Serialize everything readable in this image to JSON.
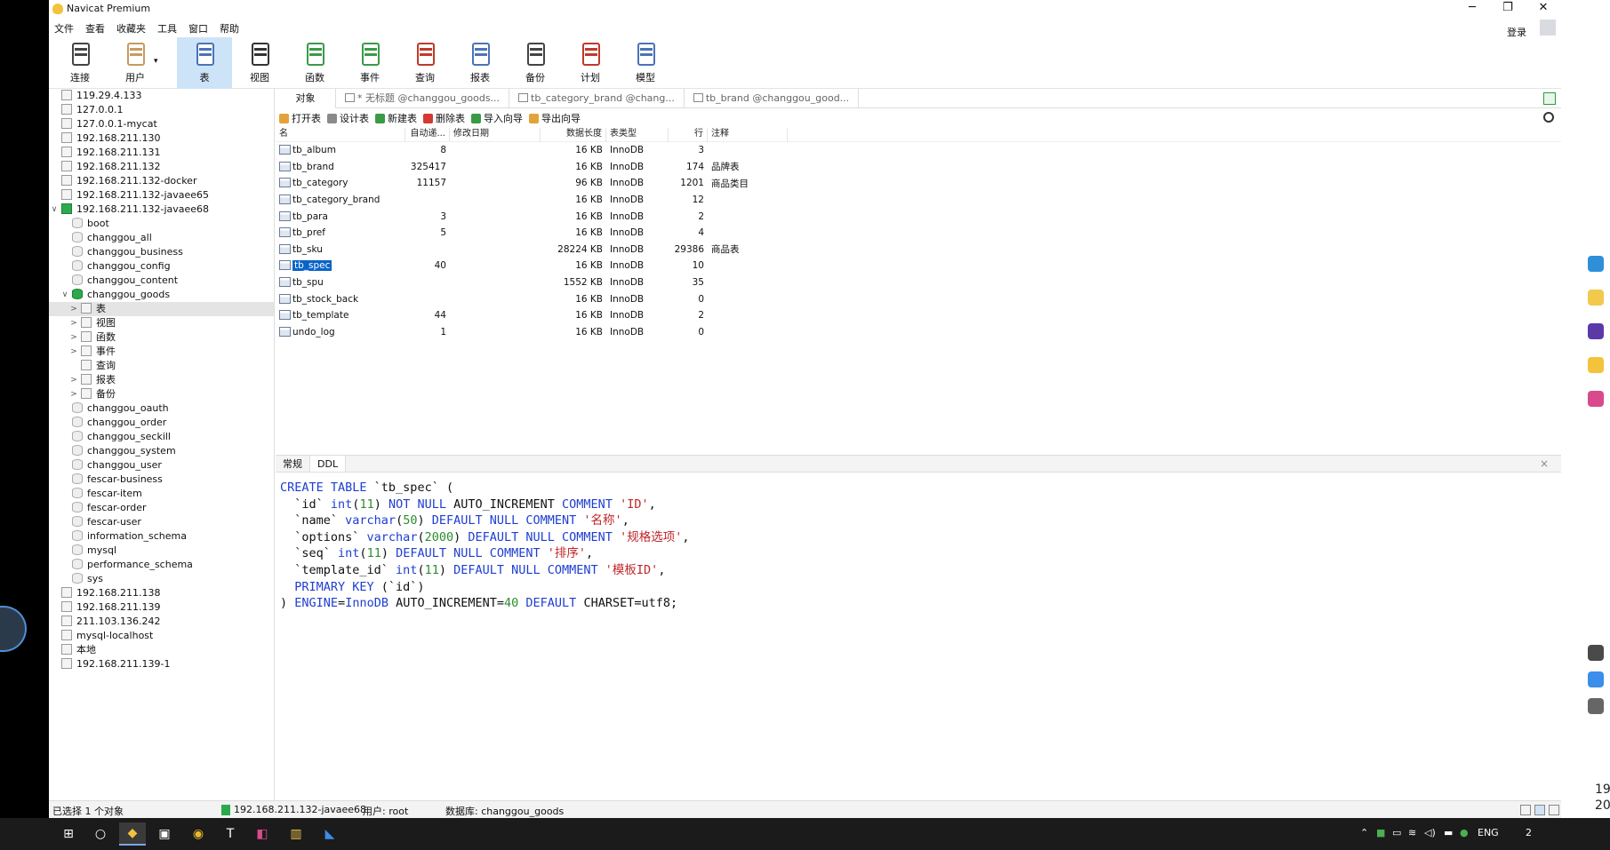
{
  "app": {
    "title": "Navicat Premium",
    "window_buttons": [
      "─",
      "❐",
      "✕"
    ],
    "login_label": "登录"
  },
  "menu": [
    "文件",
    "查看",
    "收藏夹",
    "工具",
    "窗口",
    "帮助"
  ],
  "toolbar": [
    {
      "label": "连接",
      "icon": "plug-icon",
      "color": "#444444"
    },
    {
      "label": "用户",
      "icon": "user-icon",
      "color": "#c89a62"
    },
    {
      "label": "表",
      "icon": "table-icon",
      "color": "#4a73b8",
      "selected": true
    },
    {
      "label": "视图",
      "icon": "view-icon",
      "color": "#333333"
    },
    {
      "label": "函数",
      "icon": "function-icon",
      "color": "#3a9a48"
    },
    {
      "label": "事件",
      "icon": "event-icon",
      "color": "#3a9a48"
    },
    {
      "label": "查询",
      "icon": "query-icon",
      "color": "#c0392b"
    },
    {
      "label": "报表",
      "icon": "report-icon",
      "color": "#4a73b8"
    },
    {
      "label": "备份",
      "icon": "backup-icon",
      "color": "#444444"
    },
    {
      "label": "计划",
      "icon": "schedule-icon",
      "color": "#c0392b"
    },
    {
      "label": "模型",
      "icon": "model-icon",
      "color": "#4a73b8"
    }
  ],
  "tree": [
    {
      "label": "119.29.4.133",
      "level": 0,
      "kind": "conn"
    },
    {
      "label": "127.0.0.1",
      "level": 0,
      "kind": "conn"
    },
    {
      "label": "127.0.0.1-mycat",
      "level": 0,
      "kind": "conn"
    },
    {
      "label": "192.168.211.130",
      "level": 0,
      "kind": "conn"
    },
    {
      "label": "192.168.211.131",
      "level": 0,
      "kind": "conn"
    },
    {
      "label": "192.168.211.132",
      "level": 0,
      "kind": "conn"
    },
    {
      "label": "192.168.211.132-docker",
      "level": 0,
      "kind": "conn"
    },
    {
      "label": "192.168.211.132-javaee65",
      "level": 0,
      "kind": "conn"
    },
    {
      "label": "192.168.211.132-javaee68",
      "level": 0,
      "kind": "conn-on",
      "arrow": "∨"
    },
    {
      "label": "boot",
      "level": 1,
      "kind": "db"
    },
    {
      "label": "changgou_all",
      "level": 1,
      "kind": "db"
    },
    {
      "label": "changgou_business",
      "level": 1,
      "kind": "db"
    },
    {
      "label": "changgou_config",
      "level": 1,
      "kind": "db"
    },
    {
      "label": "changgou_content",
      "level": 1,
      "kind": "db"
    },
    {
      "label": "changgou_goods",
      "level": 1,
      "kind": "db-on",
      "arrow": "∨"
    },
    {
      "label": "表",
      "level": 2,
      "kind": "tbl",
      "arrow": ">",
      "selected": true
    },
    {
      "label": "视图",
      "level": 2,
      "kind": "view",
      "arrow": ">"
    },
    {
      "label": "函数",
      "level": 2,
      "kind": "func",
      "arrow": ">"
    },
    {
      "label": "事件",
      "level": 2,
      "kind": "event",
      "arrow": ">"
    },
    {
      "label": "查询",
      "level": 2,
      "kind": "query"
    },
    {
      "label": "报表",
      "level": 2,
      "kind": "report",
      "arrow": ">"
    },
    {
      "label": "备份",
      "level": 2,
      "kind": "backup",
      "arrow": ">"
    },
    {
      "label": "changgou_oauth",
      "level": 1,
      "kind": "db"
    },
    {
      "label": "changgou_order",
      "level": 1,
      "kind": "db"
    },
    {
      "label": "changgou_seckill",
      "level": 1,
      "kind": "db"
    },
    {
      "label": "changgou_system",
      "level": 1,
      "kind": "db"
    },
    {
      "label": "changgou_user",
      "level": 1,
      "kind": "db"
    },
    {
      "label": "fescar-business",
      "level": 1,
      "kind": "db"
    },
    {
      "label": "fescar-item",
      "level": 1,
      "kind": "db"
    },
    {
      "label": "fescar-order",
      "level": 1,
      "kind": "db"
    },
    {
      "label": "fescar-user",
      "level": 1,
      "kind": "db"
    },
    {
      "label": "information_schema",
      "level": 1,
      "kind": "db"
    },
    {
      "label": "mysql",
      "level": 1,
      "kind": "db"
    },
    {
      "label": "performance_schema",
      "level": 1,
      "kind": "db"
    },
    {
      "label": "sys",
      "level": 1,
      "kind": "db"
    },
    {
      "label": "192.168.211.138",
      "level": 0,
      "kind": "conn"
    },
    {
      "label": "192.168.211.139",
      "level": 0,
      "kind": "conn"
    },
    {
      "label": "211.103.136.242",
      "level": 0,
      "kind": "conn"
    },
    {
      "label": "mysql-localhost",
      "level": 0,
      "kind": "conn"
    },
    {
      "label": "本地",
      "level": 0,
      "kind": "conn"
    },
    {
      "label": "192.168.211.139-1",
      "level": 0,
      "kind": "conn"
    }
  ],
  "tabs": {
    "object": "对象",
    "open": [
      "* 无标题 @changgou_goods...",
      "tb_category_brand @chang...",
      "tb_brand @changgou_good..."
    ]
  },
  "object_toolbar": [
    {
      "label": "打开表",
      "color": "#e3a33b"
    },
    {
      "label": "设计表",
      "color": "#8a8a8a"
    },
    {
      "label": "新建表",
      "color": "#3a9a48"
    },
    {
      "label": "删除表",
      "color": "#d43a2f"
    },
    {
      "label": "导入向导",
      "color": "#3a9a48"
    },
    {
      "label": "导出向导",
      "color": "#e3a33b"
    }
  ],
  "table": {
    "columns": [
      "名",
      "自动递...",
      "修改日期",
      "数据长度",
      "表类型",
      "行",
      "注释"
    ],
    "rows": [
      [
        "tb_album",
        "8",
        "",
        "16 KB",
        "InnoDB",
        "3",
        ""
      ],
      [
        "tb_brand",
        "325417",
        "",
        "16 KB",
        "InnoDB",
        "174",
        "品牌表"
      ],
      [
        "tb_category",
        "11157",
        "",
        "96 KB",
        "InnoDB",
        "1201",
        "商品类目"
      ],
      [
        "tb_category_brand",
        "",
        "",
        "16 KB",
        "InnoDB",
        "12",
        ""
      ],
      [
        "tb_para",
        "3",
        "",
        "16 KB",
        "InnoDB",
        "2",
        ""
      ],
      [
        "tb_pref",
        "5",
        "",
        "16 KB",
        "InnoDB",
        "4",
        ""
      ],
      [
        "tb_sku",
        "",
        "",
        "28224 KB",
        "InnoDB",
        "29386",
        "商品表"
      ],
      [
        "tb_spec",
        "40",
        "",
        "16 KB",
        "InnoDB",
        "10",
        ""
      ],
      [
        "tb_spu",
        "",
        "",
        "1552 KB",
        "InnoDB",
        "35",
        ""
      ],
      [
        "tb_stock_back",
        "",
        "",
        "16 KB",
        "InnoDB",
        "0",
        ""
      ],
      [
        "tb_template",
        "44",
        "",
        "16 KB",
        "InnoDB",
        "2",
        ""
      ],
      [
        "undo_log",
        "1",
        "",
        "16 KB",
        "InnoDB",
        "0",
        ""
      ]
    ],
    "selected_row": "tb_spec"
  },
  "bottom_tabs": [
    "常规",
    "DDL"
  ],
  "bottom_close": "×",
  "ddl": [
    [
      [
        "kw",
        "CREATE TABLE "
      ],
      [
        "tx",
        "`tb_spec` ("
      ]
    ],
    [
      [
        "tx",
        "  `id` "
      ],
      [
        "ty",
        "int"
      ],
      [
        "tx",
        "("
      ],
      [
        "nu",
        "11"
      ],
      [
        "tx",
        ") "
      ],
      [
        "kw",
        "NOT NULL "
      ],
      [
        "tx",
        "AUTO_INCREMENT "
      ],
      [
        "kw",
        "COMMENT "
      ],
      [
        "st",
        "'ID'"
      ],
      [
        "tx",
        ","
      ]
    ],
    [
      [
        "tx",
        "  `name` "
      ],
      [
        "ty",
        "varchar"
      ],
      [
        "tx",
        "("
      ],
      [
        "nu",
        "50"
      ],
      [
        "tx",
        ") "
      ],
      [
        "kw",
        "DEFAULT NULL COMMENT "
      ],
      [
        "st",
        "'名称'"
      ],
      [
        "tx",
        ","
      ]
    ],
    [
      [
        "tx",
        "  `options` "
      ],
      [
        "ty",
        "varchar"
      ],
      [
        "tx",
        "("
      ],
      [
        "nu",
        "2000"
      ],
      [
        "tx",
        ") "
      ],
      [
        "kw",
        "DEFAULT NULL COMMENT "
      ],
      [
        "st",
        "'规格选项'"
      ],
      [
        "tx",
        ","
      ]
    ],
    [
      [
        "tx",
        "  `seq` "
      ],
      [
        "ty",
        "int"
      ],
      [
        "tx",
        "("
      ],
      [
        "nu",
        "11"
      ],
      [
        "tx",
        ") "
      ],
      [
        "kw",
        "DEFAULT NULL COMMENT "
      ],
      [
        "st",
        "'排序'"
      ],
      [
        "tx",
        ","
      ]
    ],
    [
      [
        "tx",
        "  `template_id` "
      ],
      [
        "ty",
        "int"
      ],
      [
        "tx",
        "("
      ],
      [
        "nu",
        "11"
      ],
      [
        "tx",
        ") "
      ],
      [
        "kw",
        "DEFAULT NULL COMMENT "
      ],
      [
        "st",
        "'模板ID'"
      ],
      [
        "tx",
        ","
      ]
    ],
    [
      [
        "kw",
        "  PRIMARY KEY "
      ],
      [
        "tx",
        "(`id`)"
      ]
    ],
    [
      [
        "tx",
        ") "
      ],
      [
        "kw",
        "ENGINE"
      ],
      [
        "tx",
        "="
      ],
      [
        "ty",
        "InnoDB "
      ],
      [
        "tx",
        "AUTO_INCREMENT="
      ],
      [
        "nu",
        "40 "
      ],
      [
        "kw",
        "DEFAULT "
      ],
      [
        "tx",
        "CHARSET=utf8;"
      ]
    ]
  ],
  "status": {
    "selection": "已选择 1 个对象",
    "connection": "192.168.211.132-javaee68",
    "user": "用户: root",
    "database": "数据库: changgou_goods"
  },
  "taskbar": {
    "apps": [
      {
        "name": "start-icon",
        "glyph": "⊞"
      },
      {
        "name": "cortana-icon",
        "glyph": "○"
      },
      {
        "name": "navicat-taskbar-icon",
        "glyph": "◆",
        "active": true,
        "color": "#f3c33b"
      },
      {
        "name": "screenshot-taskbar-icon",
        "glyph": "▣"
      },
      {
        "name": "chrome-taskbar-icon",
        "glyph": "◉",
        "color": "#e9b82c"
      },
      {
        "name": "typora-taskbar-icon",
        "glyph": "T"
      },
      {
        "name": "intellij-taskbar-icon",
        "glyph": "◧",
        "color": "#d94a8c"
      },
      {
        "name": "folder-taskbar-icon",
        "glyph": "▥",
        "color": "#f2c94c"
      },
      {
        "name": "vscode-taskbar-icon",
        "glyph": "◣",
        "color": "#3b8eea"
      }
    ],
    "lang": "ENG",
    "notify_count": "2"
  },
  "clock_partial": [
    "19",
    "20"
  ]
}
